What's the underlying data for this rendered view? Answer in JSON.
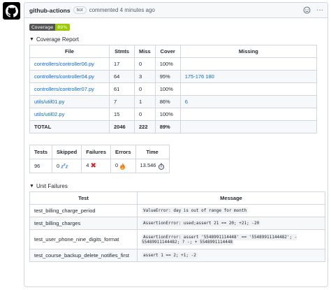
{
  "comment": {
    "author": "github-actions",
    "bot_label": "bot",
    "meta": "commented 4 minutes ago"
  },
  "badge": {
    "label": "Coverage",
    "value": "89%",
    "value_color": "#97ca00"
  },
  "coverage_report": {
    "summary": "Coverage Report",
    "headers": [
      "File",
      "Stmts",
      "Miss",
      "Cover",
      "Missing"
    ],
    "rows": [
      {
        "file": "controllers/controller06.py",
        "stmts": "17",
        "miss": "0",
        "cover": "100%",
        "missing": ""
      },
      {
        "file": "controllers/controller04.py",
        "stmts": "64",
        "miss": "3",
        "cover": "95%",
        "missing": "175-176 180"
      },
      {
        "file": "controllers/controller07.py",
        "stmts": "61",
        "miss": "0",
        "cover": "100%",
        "missing": ""
      },
      {
        "file": "utils/util01.py",
        "stmts": "7",
        "miss": "1",
        "cover": "86%",
        "missing": "6"
      },
      {
        "file": "utils/util02.py",
        "stmts": "15",
        "miss": "0",
        "cover": "100%",
        "missing": ""
      }
    ],
    "total": {
      "label": "TOTAL",
      "stmts": "2046",
      "miss": "222",
      "cover": "89%",
      "missing": ""
    }
  },
  "test_stats": {
    "headers": [
      "Tests",
      "Skipped",
      "Failures",
      "Errors",
      "Time"
    ],
    "values": [
      "96",
      "0",
      "4",
      "0",
      "13.546"
    ],
    "icons": [
      "",
      "zzz-icon",
      "cross-mark-icon",
      "fire-icon",
      "stopwatch-icon"
    ]
  },
  "unit_failures": {
    "summary": "Unit Failures",
    "headers": [
      "Test",
      "Message"
    ],
    "rows": [
      {
        "test": "test_billing_charge_period",
        "message": "ValueError: day is out of range for month"
      },
      {
        "test": "test_billing_charges",
        "message": "AssertionError: used;assert 21 == 20; +21; -20"
      },
      {
        "test": "test_user_phone_nine_digits_format",
        "message": "AssertionError: assert '5548991114448' == '55489911144482'; - 55489911144482; ? -; + 5548991114448"
      },
      {
        "test": "test_course_backup_delete_notifies_first",
        "message": "assert 1 == 2; +1; -2"
      }
    ]
  },
  "colors": {
    "link": "#0969da",
    "border": "#d0d7de",
    "header_bg": "#f6f8fa"
  }
}
